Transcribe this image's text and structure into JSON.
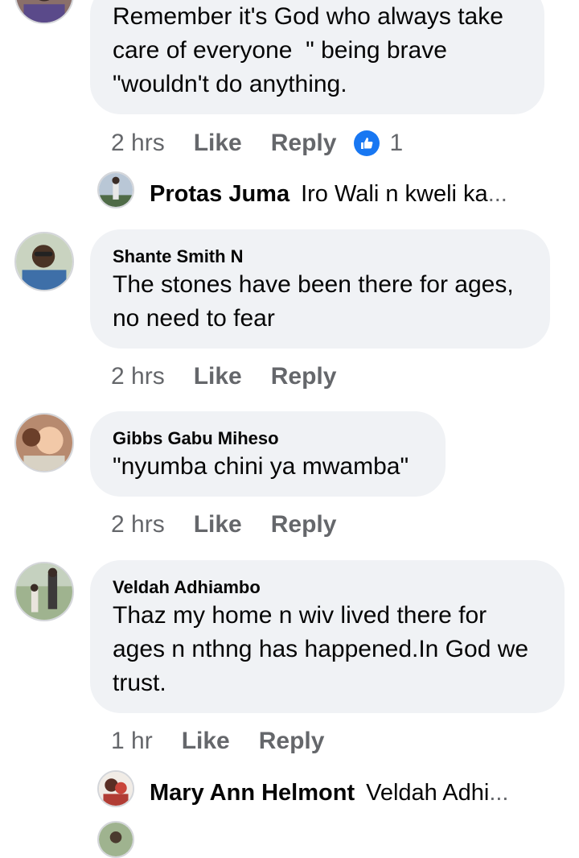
{
  "comments": [
    {
      "author": "",
      "text": "Remember it's God who always take\ncare of everyone  \" being brave\n\"wouldn't do anything.",
      "time": "2 hrs",
      "like": "Like",
      "reply": "Reply",
      "reaction_count": "1"
    },
    {
      "author": "Shante Smith N",
      "text": "The stones have been there for ages,\nno need to fear",
      "time": "2 hrs",
      "like": "Like",
      "reply": "Reply"
    },
    {
      "author": "Gibbs Gabu Miheso",
      "text": "\"nyumba chini ya mwamba\"",
      "time": "2 hrs",
      "like": "Like",
      "reply": "Reply"
    },
    {
      "author": "Veldah Adhiambo",
      "text": "Thaz my home n wiv lived there for\nages n nthng has happened.In God we\ntrust.",
      "time": "1 hr",
      "like": "Like",
      "reply": "Reply"
    }
  ],
  "replies": [
    {
      "author": "Protas Juma",
      "text": "Iro Wali n kweli ka",
      "ellipsis": "..."
    },
    {
      "author": "Mary Ann Helmont",
      "text": "Veldah Adhi",
      "ellipsis": "..."
    }
  ],
  "icons": {
    "reaction": "like-thumb-icon"
  },
  "colors": {
    "bubble": "#f0f2f5",
    "secondary_text": "#65676b",
    "like_blue": "#1877f2"
  }
}
